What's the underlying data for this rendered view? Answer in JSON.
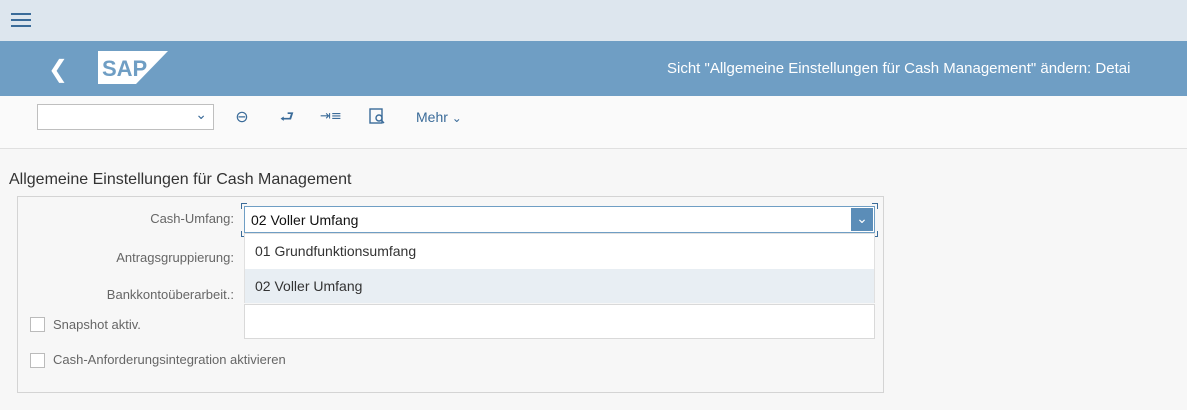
{
  "header": {
    "title": "Sicht \"Allgemeine Einstellungen für Cash Management\" ändern: Detai",
    "logo_text": "SAP"
  },
  "toolbar": {
    "select_value": "",
    "more_label": "Mehr"
  },
  "section": {
    "title": "Allgemeine Einstellungen für Cash Management"
  },
  "form": {
    "cash_umfang_label": "Cash-Umfang:",
    "cash_umfang_value": "02 Voller Umfang",
    "antragsgruppierung_label": "Antragsgruppierung:",
    "bankkonto_label": "Bankkontoüberarbeit.:",
    "snapshot_label": "Snapshot aktiv.",
    "cash_anforderung_label": "Cash-Anforderungsintegration aktivieren",
    "options": [
      {
        "label": "01 Grundfunktionsumfang",
        "selected": false
      },
      {
        "label": "02 Voller Umfang",
        "selected": true
      }
    ]
  },
  "colors": {
    "header_bg": "#6f9ec4",
    "topbar_bg": "#dde6ee",
    "accent": "#3a6b99"
  },
  "icons": [
    "menu-icon",
    "back-icon",
    "minus-circle-icon",
    "undo-icon",
    "indent-icon",
    "display-icon",
    "chevron-down-icon"
  ]
}
